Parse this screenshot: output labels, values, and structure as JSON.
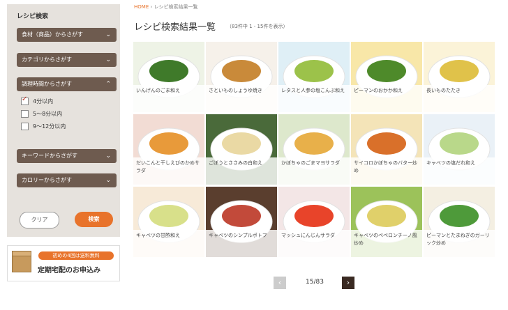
{
  "sidebar": {
    "title": "レシピ検索",
    "sections": [
      {
        "label": "食材（商品）からさがす",
        "state": "collapsed"
      },
      {
        "label": "カテゴリからさがす",
        "state": "collapsed"
      },
      {
        "label": "調理時間からさがす",
        "state": "expanded"
      },
      {
        "label": "キーワードからさがす",
        "state": "collapsed"
      },
      {
        "label": "カロリーからさがす",
        "state": "collapsed"
      }
    ],
    "time_options": [
      {
        "label": "4分以内",
        "checked": true
      },
      {
        "label": "5〜8分以内",
        "checked": false
      },
      {
        "label": "9〜12分以内",
        "checked": false
      }
    ],
    "clear_label": "クリア",
    "search_label": "検索",
    "accent_color": "#e8732b",
    "header_color": "#6e5b4f"
  },
  "banner": {
    "pill": "初めの4回は送料無料",
    "main": "定期宅配のお申込み",
    "icon": "box-icon"
  },
  "breadcrumb": {
    "home": "HOME",
    "sep": "›",
    "current": "レシピ検索結果一覧"
  },
  "results": {
    "title": "レシピ検索結果一覧",
    "count": "（83件中 1 - 15件を表示）",
    "items": [
      {
        "caption": "いんげんのごま和え",
        "bg": "#eef3e6",
        "food": "#3f7a2a"
      },
      {
        "caption": "さといものしょうゆ焼き",
        "bg": "#f6f1ea",
        "food": "#c98a3a"
      },
      {
        "caption": "レタスと人参の塩こんぶ和え",
        "bg": "#dfeff6",
        "food": "#9cc24a"
      },
      {
        "caption": "ピーマンのおかか和え",
        "bg": "#f8e7a8",
        "food": "#4e8a2a"
      },
      {
        "caption": "長いものたたき",
        "bg": "#fbf3d8",
        "food": "#e0c24a"
      },
      {
        "caption": "だいこんと干しえびのかめサラダ",
        "bg": "#f2dcd4",
        "food": "#e89a3a"
      },
      {
        "caption": "ごぼうとささみの白和え",
        "bg": "#4a6a3a",
        "food": "#ead9a4"
      },
      {
        "caption": "かぼちゃのごまマヨサラダ",
        "bg": "#dde8cc",
        "food": "#e8b04a"
      },
      {
        "caption": "サイコロかぼちゃのバター炒め",
        "bg": "#f4e4b8",
        "food": "#d9702a"
      },
      {
        "caption": "キャベツの塩だれ和え",
        "bg": "#eaf1f7",
        "food": "#b9d88a"
      },
      {
        "caption": "キャベツの甘酢和え",
        "bg": "#f7ead8",
        "food": "#d8e08a"
      },
      {
        "caption": "キャベツのシンプルポトフ",
        "bg": "#5a3e2e",
        "food": "#c24a3a"
      },
      {
        "caption": "マッシュにんじんサラダ",
        "bg": "#f3e6e6",
        "food": "#e8442a"
      },
      {
        "caption": "キャベツのペペロンチーノ風炒め",
        "bg": "#9cc25a",
        "food": "#e0d06a"
      },
      {
        "caption": "ピーマンとたまねぎのガーリック炒め",
        "bg": "#f4efe2",
        "food": "#4e9a3a"
      }
    ]
  },
  "pagination": {
    "prev": "‹",
    "info": "15/83",
    "next": "›"
  }
}
